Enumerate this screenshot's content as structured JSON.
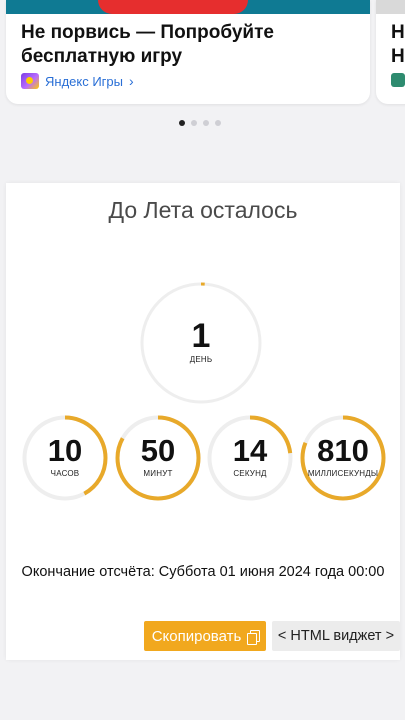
{
  "promo": {
    "title": "Не порвись — Попробуйте бесплатную игру",
    "source_label": "Яндекс Игры",
    "source_icon": "yandex-games-logo",
    "chevron_icon": "chevron-right-icon",
    "next_card_partial": [
      "Н",
      "Н"
    ],
    "dots_count": 4,
    "active_dot": 0
  },
  "widget": {
    "title": "До Лета осталось",
    "accent_color": "#e8a92a",
    "track_color": "#eeeeee",
    "days": {
      "value": "1",
      "label": "ДЕНЬ",
      "progress": 0.01
    },
    "units": [
      {
        "value": "10",
        "label": "ЧАСОВ",
        "progress": 0.42
      },
      {
        "value": "50",
        "label": "МИНУТ",
        "progress": 0.83
      },
      {
        "value": "14",
        "label": "СЕКУНД",
        "progress": 0.23
      },
      {
        "value": "810",
        "label": "МИЛЛИСЕКУНДЫ",
        "progress": 0.81
      }
    ],
    "end_text": "Окончание отсчёта: Суббота 01 июня 2024 года 00:00",
    "copy_label": "Скопировать",
    "copy_icon": "copy-icon",
    "html_label": "< HTML виджет >"
  }
}
